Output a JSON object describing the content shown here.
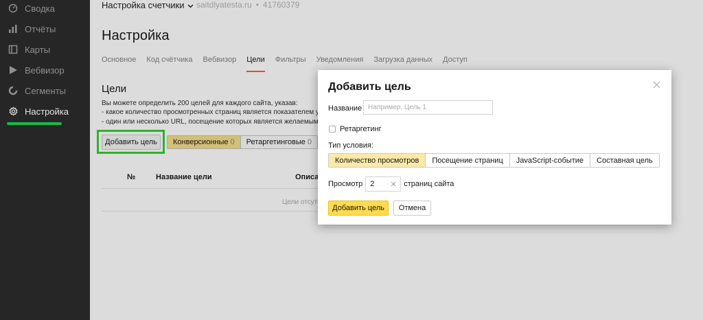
{
  "sidebar": {
    "items": [
      {
        "label": "Сводка",
        "icon": "gauge-icon"
      },
      {
        "label": "Отчёты",
        "icon": "bar-chart-icon"
      },
      {
        "label": "Карты",
        "icon": "map-icon"
      },
      {
        "label": "Вебвизор",
        "icon": "play-icon"
      },
      {
        "label": "Сегменты",
        "icon": "pie-icon"
      },
      {
        "label": "Настройка",
        "icon": "gear-icon"
      }
    ]
  },
  "header": {
    "counter_select": "Настройка счетчики",
    "site": "saitdlyatesta.ru",
    "counter_id": "41760379"
  },
  "page": {
    "title": "Настройка",
    "tabs": [
      "Основное",
      "Код счётчика",
      "Вебвизор",
      "Цели",
      "Фильтры",
      "Уведомления",
      "Загрузка данных",
      "Доступ"
    ],
    "active_tab": "Цели"
  },
  "goals": {
    "title": "Цели",
    "desc_line1": "Вы можете определить 200 целей для каждого сайта, указав:",
    "desc_line2": "- какое количество просмотренных страниц является показателем усп",
    "desc_line3": "- один или несколько URL, посещение которых является желаемым д",
    "add_button": "Добавить цель",
    "filters": [
      {
        "label": "Конверсионные",
        "count": "0"
      },
      {
        "label": "Ретаргетинговые",
        "count": "0"
      }
    ],
    "table_headers": {
      "num": "№",
      "name": "Название цели",
      "desc": "Описан"
    },
    "empty_message": "Цели отсутс"
  },
  "modal": {
    "title": "Добавить цель",
    "name_label": "Название",
    "name_placeholder": "Например, Цель 1",
    "retargeting_label": "Ретаргетинг",
    "condition_label": "Тип условия:",
    "conditions": [
      "Количество просмотров",
      "Посещение страниц",
      "JavaScript-событие",
      "Составная цель"
    ],
    "active_condition": "Количество просмотров",
    "views_label": "Просмотр",
    "views_value": "2",
    "views_suffix": "страниц сайта",
    "submit": "Добавить цель",
    "cancel": "Отмена"
  },
  "colors": {
    "sidebar_bg": "#262626",
    "accent_green": "#1db74a",
    "highlight_green": "#2bb32b",
    "tab_underline": "#e3473d",
    "primary_button": "#ffdb4d",
    "active_condition_bg": "#fce9a8"
  }
}
